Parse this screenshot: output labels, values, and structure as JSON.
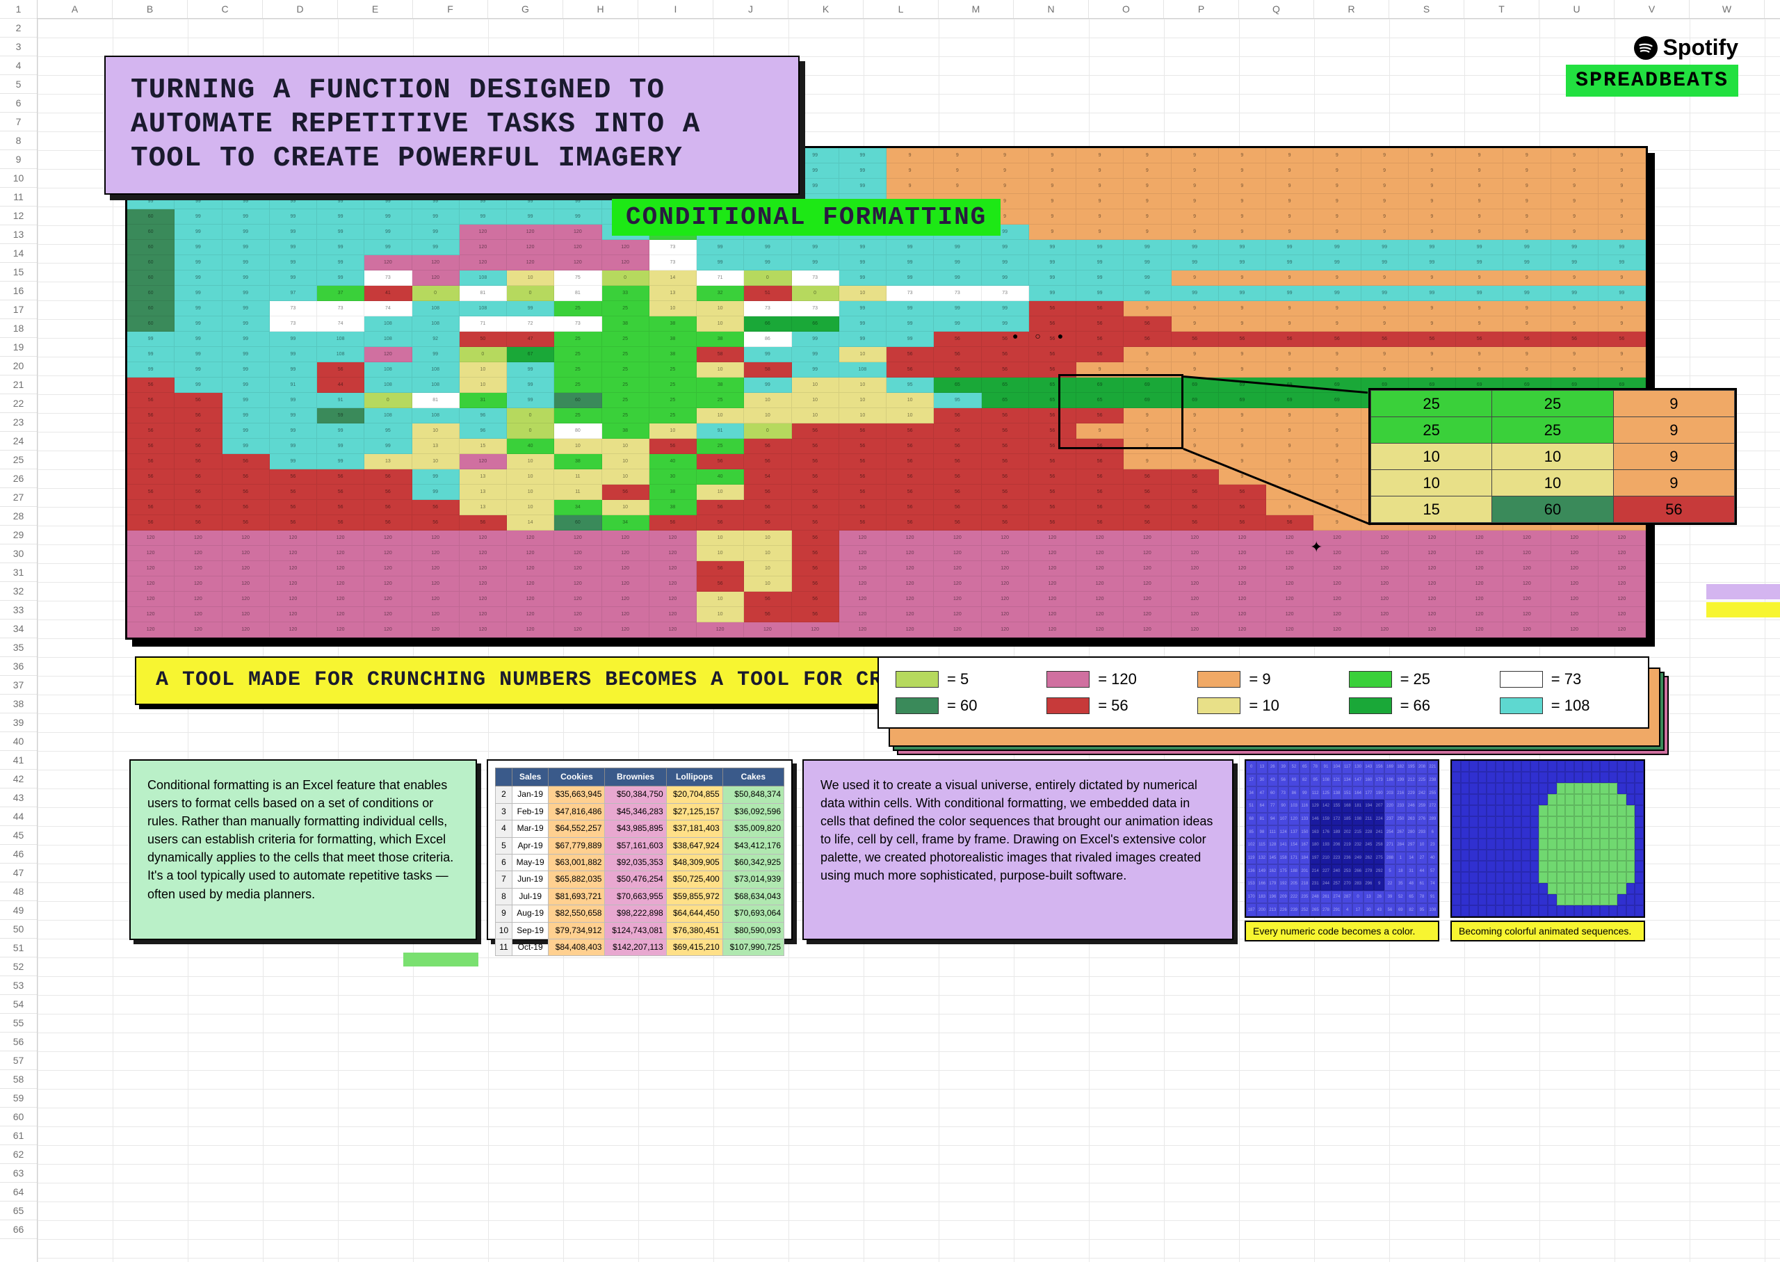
{
  "logo": {
    "brand": "Spotify",
    "product": "SPREADBEATS"
  },
  "title": "Turning a function designed to automate repetitive tasks into a tool to create powerful imagery",
  "subtitle": "CONDITIONAL FORMATTING",
  "strap": "A tool made for crunching numbers becomes a tool for crafting visuals",
  "legend": [
    {
      "value": 5,
      "color": "#b6d95e"
    },
    {
      "value": 120,
      "color": "#d070a0"
    },
    {
      "value": 9,
      "color": "#f0a966"
    },
    {
      "value": 25,
      "color": "#3ad03a"
    },
    {
      "value": 73,
      "color": "#ffffff"
    },
    {
      "value": 60,
      "color": "#3a8a5a"
    },
    {
      "value": 56,
      "color": "#c73a3a"
    },
    {
      "value": 10,
      "color": "#e8e088"
    },
    {
      "value": 66,
      "color": "#1aa838"
    },
    {
      "value": 108,
      "color": "#5ed8d0"
    }
  ],
  "zoom_cells": [
    [
      {
        "v": 25,
        "c": "c25"
      },
      {
        "v": 25,
        "c": "c25"
      },
      {
        "v": 9,
        "c": "c9"
      }
    ],
    [
      {
        "v": 25,
        "c": "c25"
      },
      {
        "v": 25,
        "c": "c25"
      },
      {
        "v": 9,
        "c": "c9"
      }
    ],
    [
      {
        "v": 10,
        "c": "c10"
      },
      {
        "v": 10,
        "c": "c10"
      },
      {
        "v": 9,
        "c": "c9"
      }
    ],
    [
      {
        "v": 10,
        "c": "c10"
      },
      {
        "v": 10,
        "c": "c10"
      },
      {
        "v": 9,
        "c": "c9"
      }
    ],
    [
      {
        "v": 15,
        "c": "c10"
      },
      {
        "v": 60,
        "c": "c60"
      },
      {
        "v": 56,
        "c": "c56"
      }
    ]
  ],
  "card_green": "Conditional formatting is an Excel feature that enables users to format cells based on a set of conditions or rules. Rather than manually formatting individual cells, users can establish criteria for formatting, which Excel dynamically applies to the cells that meet those criteria. It's a tool typically used to automate repetitive tasks — often used by media planners.",
  "card_purple": "We used it to create a visual universe, entirely dictated by numerical data within cells. With conditional formatting, we embedded data in cells that defined the color sequences that brought our animation ideas to life, cell by cell, frame by frame. Drawing on Excel's extensive color palette, we created photorealistic images that rivaled images created using much more sophisticated, purpose-built software.",
  "caption1": "Every numeric code becomes a color.",
  "caption2": "Becoming colorful animated sequences.",
  "mini_table": {
    "headers": [
      "",
      "Sales",
      "Cookies",
      "Brownies",
      "Lollipops",
      "Cakes"
    ],
    "rows": [
      [
        "2",
        "Jan-19",
        "$35,663,945",
        "$50,384,750",
        "$20,704,855",
        "$50,848,374"
      ],
      [
        "3",
        "Feb-19",
        "$47,816,486",
        "$45,346,283",
        "$27,125,157",
        "$36,092,596"
      ],
      [
        "4",
        "Mar-19",
        "$64,552,257",
        "$43,985,895",
        "$37,181,403",
        "$35,009,820"
      ],
      [
        "5",
        "Apr-19",
        "$67,779,889",
        "$57,161,603",
        "$38,647,924",
        "$43,412,176"
      ],
      [
        "6",
        "May-19",
        "$63,001,882",
        "$92,035,353",
        "$48,309,905",
        "$60,342,925"
      ],
      [
        "7",
        "Jun-19",
        "$65,882,035",
        "$50,476,254",
        "$50,725,400",
        "$73,014,939"
      ],
      [
        "8",
        "Jul-19",
        "$81,693,721",
        "$70,663,955",
        "$59,855,972",
        "$68,634,043"
      ],
      [
        "9",
        "Aug-19",
        "$82,550,658",
        "$98,222,898",
        "$64,644,450",
        "$70,693,064"
      ],
      [
        "10",
        "Sep-19",
        "$79,734,912",
        "$124,743,081",
        "$76,380,451",
        "$80,590,093"
      ],
      [
        "11",
        "Oct-19",
        "$84,408,403",
        "$142,207,113",
        "$69,415,210",
        "$107,990,725"
      ]
    ]
  },
  "pixel_rows": [
    "999999999999999999999999999999999",
    "999999999999999999999999999999999",
    "999999999999999999999999999999999",
    "999999999999999999999999999999999",
    "609999999999999999999999999999999",
    "609999999999991201201209739999999999999999",
    "609999999999991201201201207399999999999999",
    "60999999991201201201201201207399999999999999",
    "609999999973120108107501471073999999999999999",
    "609999973741081081331332510107373739999999999",
    "609999737374108108992525101073739999999956569",
    "60999973741081087172733838106666999999995656569",
    "9999999910810892504725253838869999995656565656",
    "99999999108120990672525385899991056565656569",
    "99999999561081081099252525105899108565656569",
    "56999991441081081099252525389910109565656569",
    "5656999991081319960252525101010109565656569",
    "56569999591081089602525251010101010565656569",
    "565699999995109608038109105656565656569",
    "5656999999991315401010562556565656565656569",
    "56565699991310120103810405656565656565656569",
    "56565656565699131011103040545656565656565656569",
    "5656565656569913101156381056565656565656565656569",
    "5656565656565613103410385656565656565656565656569",
    "565656565656565614603456565656565656565656565656569",
    "1201201201201201201201201201201201201010561201201201201201201201201201201201201201201201201201201209",
    "120120120120120120120120120120120120101056120120120120120120120120120120120120120120120120120120120",
    "120120120120120120120120120120120120561056120120120120120120120120120120120120120120120120120120120",
    "120120120120120120120120120120120120561056120120120120120120120120120120120120120120120120120120120",
    "120120120120120120120120120120120120105656120120120120120120120120120120120120120120120120120120120",
    "120120120120120120120120120120120120105656120120120120120120120120120120120120120120120120120120120",
    "120120120120120120120120120120120120120120120120120120120120120120120120120120120120120120120120120"
  ],
  "columns": [
    "A",
    "B",
    "C",
    "D",
    "E",
    "F",
    "G",
    "H",
    "I",
    "J",
    "K",
    "L",
    "M",
    "N",
    "O",
    "P",
    "Q",
    "R",
    "S",
    "T",
    "U",
    "V",
    "W"
  ],
  "face": "● ○ ●"
}
